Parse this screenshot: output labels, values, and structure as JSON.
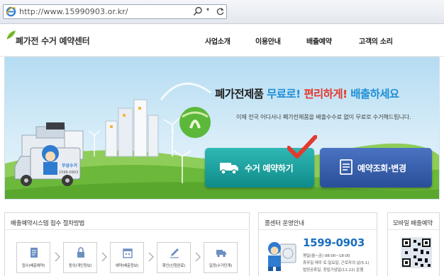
{
  "browser": {
    "url": "http://www.15990903.or.kr/"
  },
  "header": {
    "logo": "폐가전 수거 예약센터",
    "nav": [
      {
        "label": "사업소개"
      },
      {
        "label": "이용안내"
      },
      {
        "label": "배출예약"
      },
      {
        "label": "고객의 소리"
      }
    ]
  },
  "hero": {
    "headline_main": "폐가전제품",
    "headline_free": "무료로!",
    "headline_convenient": "편리하게!",
    "headline_pickup": "배출하세요",
    "subline": "이제 전국 어디서나 폐가전제품을 배출수수료 없이 무료로 수거해드립니다.",
    "truck_side_text": "무상수거",
    "truck_phone": "1599-0903",
    "reserve_button": "수거 예약하기",
    "lookup_button": "예약조회·변경",
    "colors": {
      "reserve": "#159b98",
      "lookup": "#355fae",
      "free": "#1f8fd6",
      "convenient": "#e23a2e"
    }
  },
  "panels": {
    "process": {
      "title": "배출예약시스템 접수 절차방법",
      "steps": [
        {
          "label": "접수(배출예약)",
          "icon": "form-icon"
        },
        {
          "label": "동의(개인정보)",
          "icon": "lock-icon"
        },
        {
          "label": "예약(배출정보)",
          "icon": "calendar-icon"
        },
        {
          "label": "확인(신청완료)",
          "icon": "pencil-icon"
        },
        {
          "label": "일정(수거단계)",
          "icon": "truck-icon"
        }
      ]
    },
    "callcenter": {
      "title": "콜센터 운영안내",
      "phone": "1599-0903",
      "hours_weekday": "평일(월~금) 08:00~18:00",
      "hours_holiday": "휴무일  매주 토·일요일, 근로자의 날(5.1)",
      "note": "법정공휴일, 창립기념일(11.22) 운행"
    },
    "mobile": {
      "title": "모바일 배출예약"
    }
  }
}
